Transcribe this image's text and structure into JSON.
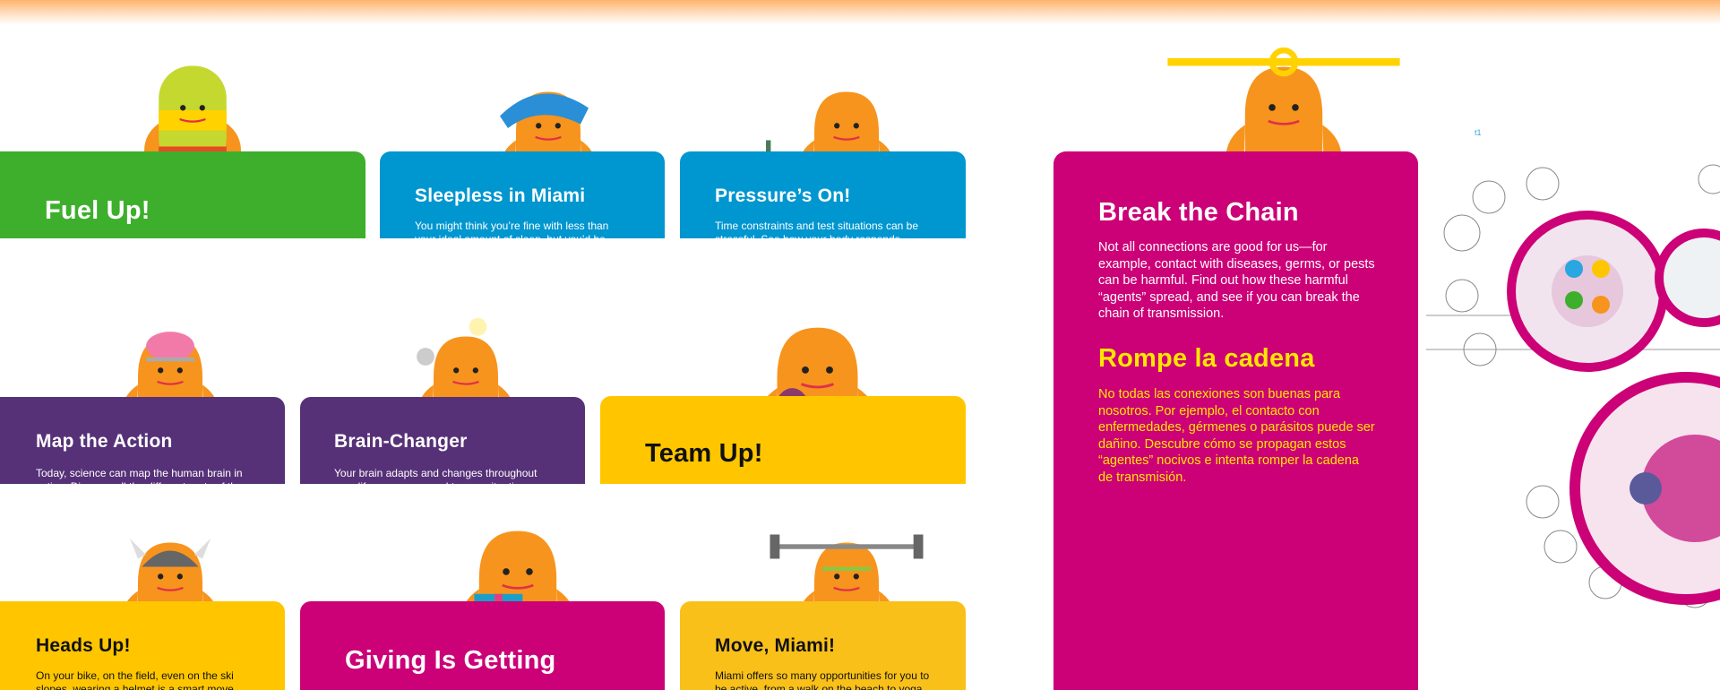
{
  "colors": {
    "green": "#3daf2c",
    "blue": "#0096cf",
    "purple": "#563178",
    "yellow": "#ffc600",
    "magenta": "#cc0077",
    "character": "#f7941d",
    "spanish_text": "#ffe600"
  },
  "cards": [
    {
      "title": "Fuel Up!",
      "text": ""
    },
    {
      "title": "Sleepless in Miami",
      "text": "You might think you’re fine with less than your ideal amount of sleep, but you’d be"
    },
    {
      "title": "Pressure’s On!",
      "text": "Time constraints and test situations can be stressful. See how your body responds"
    },
    {
      "title": "Map the Action",
      "text": "Today, science can map the human brain in action. Discover all the different parts of the"
    },
    {
      "title": "Brain-Changer",
      "text": "Your brain adapts and changes throughout your life as you respond to new situations, learn, or"
    },
    {
      "title": "Team Up!",
      "text": ""
    },
    {
      "title": "Heads Up!",
      "text": "On your bike, on the field, even on the ski slopes, wearing a helmet is a smart move."
    },
    {
      "title": "Giving Is Getting",
      "text": ""
    },
    {
      "title": "Move, Miami!",
      "text": "Miami offers so many opportunities for you to be active, from a walk on the beach to yoga"
    }
  ],
  "feature": {
    "title": "Break the Chain",
    "text": "Not all connections are good for us—for example, contact with diseases, germs, or pests can be harmful. Find out how these harmful “agents” spread, and see if you can break the chain of transmission.",
    "title_es": "Rompe la cadena",
    "text_es": "No todas las conexiones son buenas para nosotros. Por ejemplo, el contacto con enfermedades, gérmenes o parásitos puede ser dañino. Descubre cómo se propagan estos “agentes” nocivos e intenta romper la cadena de transmisión."
  },
  "floorplan_label": "t1"
}
